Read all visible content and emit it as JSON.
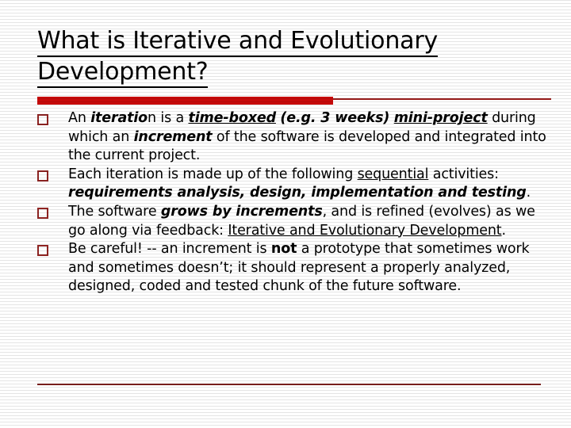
{
  "slide": {
    "title": {
      "line1": "What is Iterative and Evolutionary",
      "line2": "Development?"
    },
    "colors": {
      "title_text": "#000000",
      "divider_thick_red": "#c80b0b",
      "divider_thin_red": "#9b1a18",
      "bullet_marker_red": "#8f2422",
      "bottom_rule_red": "#7d1f1d",
      "body_text": "#000000",
      "background": "#ffffff"
    },
    "bullets": [
      {
        "marker": "hollow-square-bullet",
        "plain_text": "An iteration is a time-boxed (e.g. 3 weeks) mini-project during which an increment of the software is developed and integrated into the current project.",
        "runs": [
          {
            "t": "An ",
            "style": "normal"
          },
          {
            "t": "iteratio",
            "style": "bold-italic"
          },
          {
            "t": "n is a ",
            "style": "normal"
          },
          {
            "t": "time-boxed",
            "style": "bold-italic-underline"
          },
          {
            "t": " ",
            "style": "normal"
          },
          {
            "t": "(e.g. 3 weeks)",
            "style": "bold-italic"
          },
          {
            "t": " ",
            "style": "normal"
          },
          {
            "t": "mini-project",
            "style": "bold-italic-underline"
          },
          {
            "t": " during which an ",
            "style": "normal"
          },
          {
            "t": "increment",
            "style": "bold-italic"
          },
          {
            "t": " of the software is developed and integrated into the current project.",
            "style": "normal"
          }
        ]
      },
      {
        "marker": "hollow-square-bullet",
        "plain_text": "Each iteration is made up of the following sequential activities: requirements analysis, design, implementation and testing.",
        "runs": [
          {
            "t": "Each iteration is made up of the following ",
            "style": "normal"
          },
          {
            "t": "sequential",
            "style": "underline"
          },
          {
            "t": " activities: ",
            "style": "normal"
          },
          {
            "t": "requirements analysis, design, implementation and testing",
            "style": "bold-italic"
          },
          {
            "t": ".",
            "style": "normal"
          }
        ]
      },
      {
        "marker": "hollow-square-bullet",
        "plain_text": "The software grows by increments, and is refined (evolves) as we go along via feedback: Iterative and Evolutionary Development.",
        "runs": [
          {
            "t": "The software ",
            "style": "normal"
          },
          {
            "t": "grows by increments",
            "style": "bold-italic"
          },
          {
            "t": ", and is refined (evolves) as we go along via feedback: ",
            "style": "normal"
          },
          {
            "t": "Iterative and Evolutionary Development",
            "style": "underline"
          },
          {
            "t": ".",
            "style": "normal"
          }
        ]
      },
      {
        "marker": "hollow-square-bullet",
        "plain_text": "Be careful! -- an increment is not a prototype that sometimes work and sometimes doesn't; it should represent a properly analyzed, designed, coded and tested chunk of the future software.",
        "runs": [
          {
            "t": "Be careful! -- an increment is ",
            "style": "normal"
          },
          {
            "t": "not",
            "style": "bold"
          },
          {
            "t": " a prototype that sometimes work and sometimes doesn’t; it should represent a properly analyzed, designed, coded and tested chunk of the future software.",
            "style": "normal"
          }
        ]
      }
    ]
  }
}
